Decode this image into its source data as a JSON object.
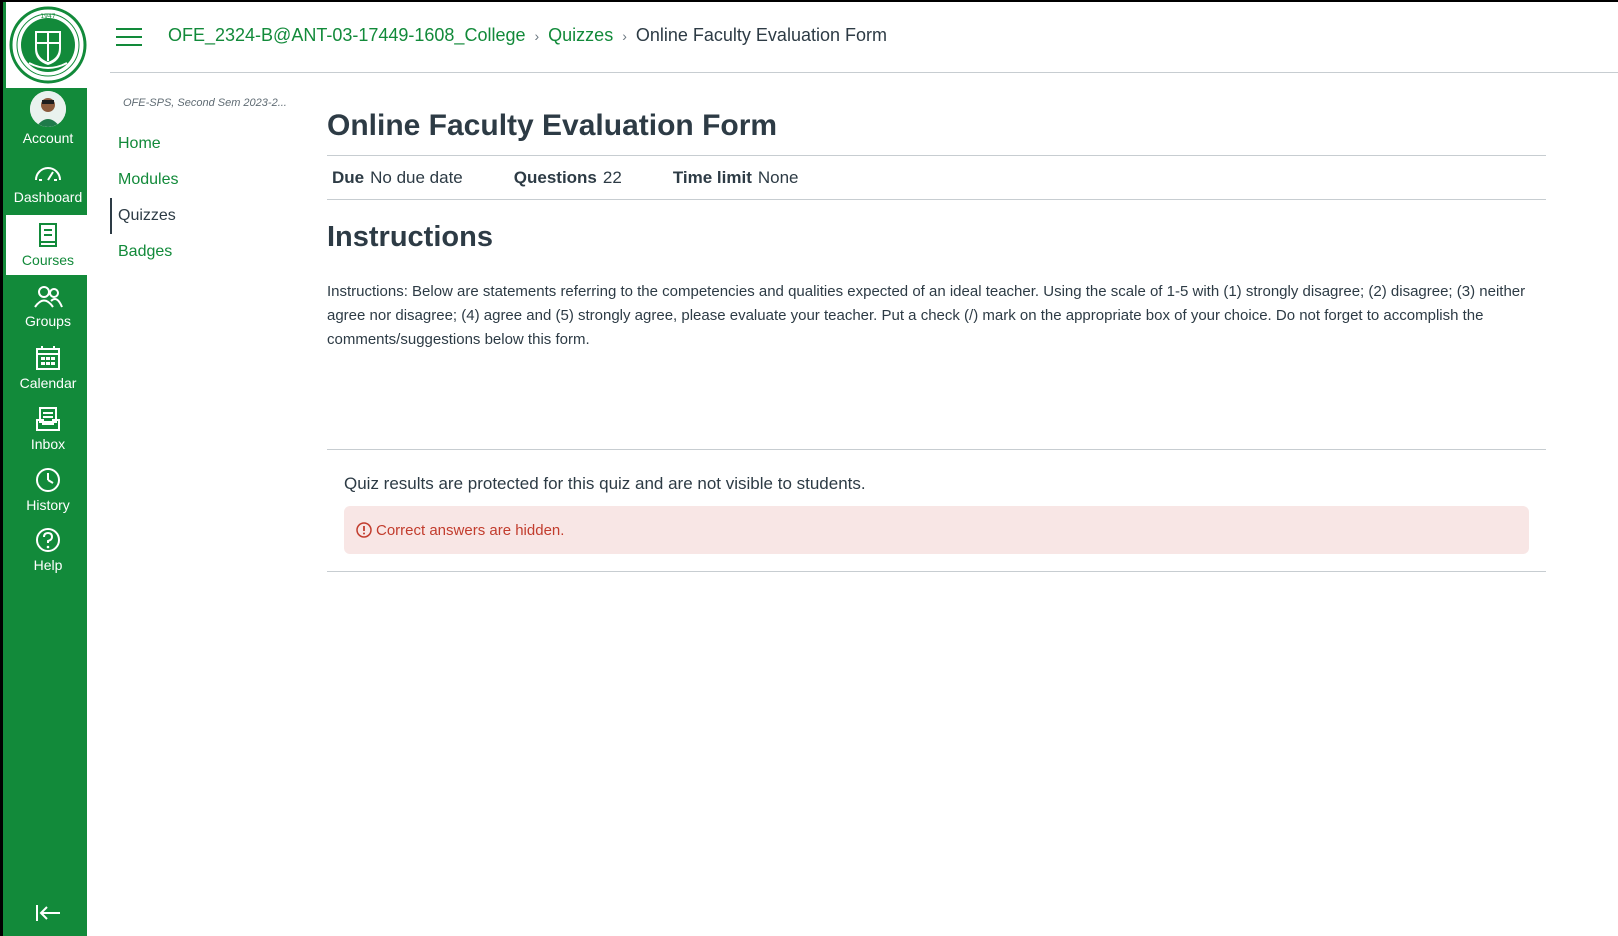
{
  "global_nav": {
    "items": [
      {
        "key": "account",
        "label": "Account",
        "icon": "user-avatar"
      },
      {
        "key": "dashboard",
        "label": "Dashboard",
        "icon": "gauge-icon"
      },
      {
        "key": "courses",
        "label": "Courses",
        "icon": "book-icon"
      },
      {
        "key": "groups",
        "label": "Groups",
        "icon": "people-icon"
      },
      {
        "key": "calendar",
        "label": "Calendar",
        "icon": "calendar-icon"
      },
      {
        "key": "inbox",
        "label": "Inbox",
        "icon": "inbox-icon"
      },
      {
        "key": "history",
        "label": "History",
        "icon": "clock-icon"
      },
      {
        "key": "help",
        "label": "Help",
        "icon": "question-icon"
      }
    ],
    "logo_year": "1947"
  },
  "breadcrumbs": {
    "course": "OFE_2324-B@ANT-03-17449-1608_College",
    "section": "Quizzes",
    "current": "Online Faculty Evaluation Form"
  },
  "course_nav": {
    "term": "OFE-SPS, Second Sem 2023-2...",
    "items": [
      "Home",
      "Modules",
      "Quizzes",
      "Badges"
    ],
    "active": "Quizzes"
  },
  "quiz": {
    "title": "Online Faculty Evaluation Form",
    "due_label": "Due",
    "due_value": "No due date",
    "questions_label": "Questions",
    "questions_value": "22",
    "time_limit_label": "Time limit",
    "time_limit_value": "None",
    "instructions_heading": "Instructions",
    "instructions_text": "Instructions: Below are statements referring to the competencies and qualities expected of an ideal teacher. Using the scale of 1-5 with (1) strongly disagree; (2) disagree; (3) neither agree nor disagree; (4) agree and (5) strongly agree, please evaluate your teacher. Put a check (/) mark on the appropriate box of your choice. Do not forget to accomplish the comments/suggestions below this form.",
    "results_message": "Quiz results are protected for this quiz and are not visible to students.",
    "alert_message": "Correct answers are hidden."
  },
  "colors": {
    "brand": "#128a3a",
    "text": "#2d3b45",
    "alert_bg": "#f8e6e5",
    "alert_text": "#c23c2d"
  }
}
